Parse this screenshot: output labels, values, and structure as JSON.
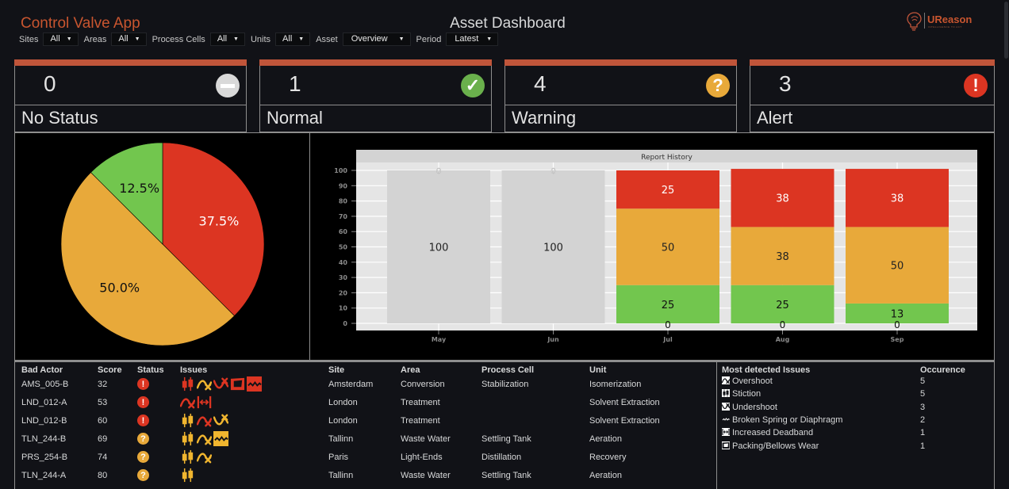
{
  "header": {
    "app_title": "Control Valve App",
    "page_title": "Asset Dashboard",
    "logo": {
      "brand_u": "U",
      "brand_rest": "Reason",
      "tagline": "INTELLIGENCE TO ACT",
      "icon": "lightbulb-brain-icon"
    }
  },
  "filters": [
    {
      "label": "Sites",
      "value": "All"
    },
    {
      "label": "Areas",
      "value": "All"
    },
    {
      "label": "Process Cells",
      "value": "All"
    },
    {
      "label": "Units",
      "value": "All"
    },
    {
      "label": "Asset",
      "value": "Overview"
    },
    {
      "label": "Period",
      "value": "Latest"
    }
  ],
  "status_cards": [
    {
      "count": "0",
      "label": "No Status",
      "icon": "minus-icon",
      "glyph": "",
      "color": "#d9d9d9"
    },
    {
      "count": "1",
      "label": "Normal",
      "icon": "check-icon",
      "glyph": "✓",
      "color": "#6ab04c"
    },
    {
      "count": "4",
      "label": "Warning",
      "icon": "question-icon",
      "glyph": "?",
      "color": "#e8a93a"
    },
    {
      "count": "3",
      "label": "Alert",
      "icon": "exclamation-icon",
      "glyph": "!",
      "color": "#dc3522"
    }
  ],
  "colors": {
    "alert": "#dc3522",
    "warning": "#e8a93a",
    "normal": "#72c64e",
    "nostatus": "#d3d3d3",
    "accent": "#c0553a"
  },
  "chart_data": [
    {
      "type": "pie",
      "title": "",
      "slices": [
        {
          "label": "Alert",
          "value": 37.5,
          "text": "37.5%",
          "color": "#dc3522",
          "text_color": "#ffffff"
        },
        {
          "label": "Warning",
          "value": 50.0,
          "text": "50.0%",
          "color": "#e8a93a",
          "text_color": "#111111"
        },
        {
          "label": "Normal",
          "value": 12.5,
          "text": "12.5%",
          "color": "#72c64e",
          "text_color": "#111111"
        }
      ]
    },
    {
      "type": "bar",
      "stacked": true,
      "title": "Report History",
      "categories": [
        "May",
        "Jun",
        "Jul",
        "Aug",
        "Sep"
      ],
      "ylim": [
        0,
        100
      ],
      "yticks": [
        0,
        10,
        20,
        30,
        40,
        50,
        60,
        70,
        80,
        90,
        100
      ],
      "grid": true,
      "series": [
        {
          "name": "No Status",
          "color": "#d3d3d3",
          "values": [
            100,
            100,
            0,
            0,
            0
          ]
        },
        {
          "name": "Normal",
          "color": "#72c64e",
          "values": [
            0,
            0,
            25,
            25,
            13
          ]
        },
        {
          "name": "Warning",
          "color": "#e8a93a",
          "values": [
            0,
            0,
            50,
            38,
            50
          ]
        },
        {
          "name": "Alert",
          "color": "#dc3522",
          "values": [
            0,
            0,
            25,
            38,
            38
          ]
        }
      ],
      "label_colors": {
        "No Status": "#222222",
        "Normal": "#111111",
        "Warning": "#222222",
        "Alert": "#ffffff"
      }
    }
  ],
  "bad_actors": {
    "headers": [
      "Bad Actor",
      "Score",
      "Status",
      "Issues",
      "Site",
      "Area",
      "Process Cell",
      "Unit"
    ],
    "rows": [
      {
        "actor": "AMS_005-B",
        "score": "32",
        "status": "alert",
        "issues": [
          [
            "stiction",
            "alert"
          ],
          [
            "overshoot",
            "warning"
          ],
          [
            "undershoot",
            "alert"
          ],
          [
            "packing",
            "alert"
          ],
          [
            "spring",
            "alert"
          ]
        ],
        "site": "Amsterdam",
        "area": "Conversion",
        "cell": "Stabilization",
        "unit": "Isomerization"
      },
      {
        "actor": "LND_012-A",
        "score": "53",
        "status": "alert",
        "issues": [
          [
            "overshoot",
            "alert"
          ],
          [
            "deadband",
            "alert"
          ]
        ],
        "site": "London",
        "area": "Treatment",
        "cell": "",
        "unit": "Solvent Extraction"
      },
      {
        "actor": "LND_012-B",
        "score": "60",
        "status": "alert",
        "issues": [
          [
            "stiction",
            "warning"
          ],
          [
            "overshoot",
            "alert"
          ],
          [
            "undershoot",
            "warning"
          ]
        ],
        "site": "London",
        "area": "Treatment",
        "cell": "",
        "unit": "Solvent Extraction"
      },
      {
        "actor": "TLN_244-B",
        "score": "69",
        "status": "warning",
        "issues": [
          [
            "stiction",
            "warning"
          ],
          [
            "overshoot",
            "warning"
          ],
          [
            "spring",
            "warning"
          ]
        ],
        "site": "Tallinn",
        "area": "Waste Water",
        "cell": "Settling Tank",
        "unit": "Aeration"
      },
      {
        "actor": "PRS_254-B",
        "score": "74",
        "status": "warning",
        "issues": [
          [
            "stiction",
            "warning"
          ],
          [
            "overshoot",
            "warning"
          ]
        ],
        "site": "Paris",
        "area": "Light-Ends",
        "cell": "Distillation",
        "unit": "Recovery"
      },
      {
        "actor": "TLN_244-A",
        "score": "80",
        "status": "warning",
        "issues": [
          [
            "stiction",
            "warning"
          ]
        ],
        "site": "Tallinn",
        "area": "Waste Water",
        "cell": "Settling Tank",
        "unit": "Aeration"
      }
    ]
  },
  "most_detected": {
    "headers": [
      "Most detected Issues",
      "Occurence"
    ],
    "rows": [
      {
        "icon": "overshoot",
        "name": "Overshoot",
        "count": "5"
      },
      {
        "icon": "stiction",
        "name": "Stiction",
        "count": "5"
      },
      {
        "icon": "undershoot",
        "name": "Undershoot",
        "count": "3"
      },
      {
        "icon": "spring",
        "name": "Broken Spring or Diaphragm",
        "count": "2"
      },
      {
        "icon": "deadband",
        "name": "Increased Deadband",
        "count": "1"
      },
      {
        "icon": "packing",
        "name": "Packing/Bellows Wear",
        "count": "1"
      }
    ]
  }
}
